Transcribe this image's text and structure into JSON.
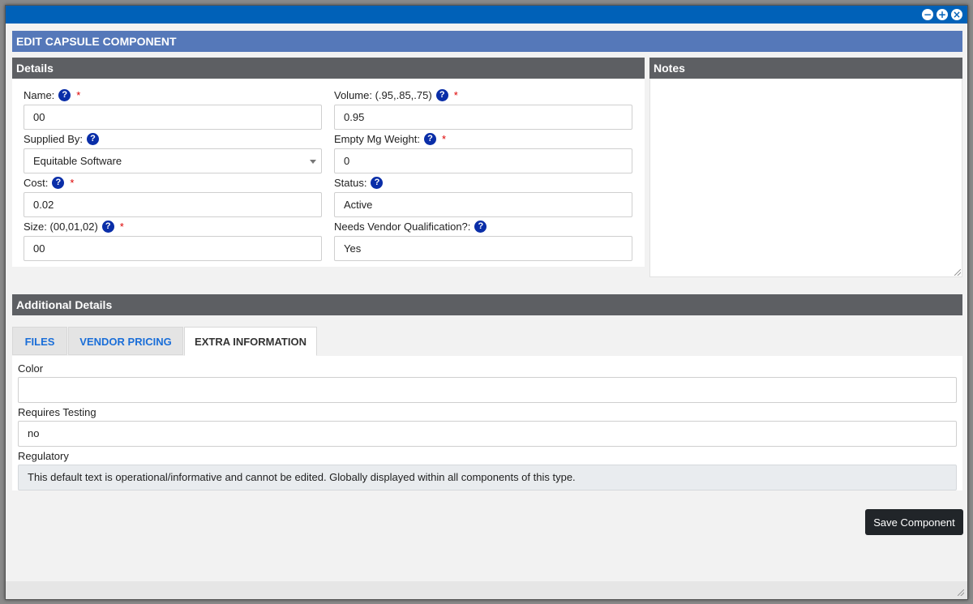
{
  "window": {
    "controls": [
      "−",
      "+",
      "×"
    ]
  },
  "dialog": {
    "title": "EDIT CAPSULE COMPONENT"
  },
  "details": {
    "title": "Details",
    "fields": [
      {
        "label": "Name:",
        "value": "00",
        "required": "*"
      },
      {
        "label": "Volume: (.95,.85,.75)",
        "value": "0.95",
        "required": "*"
      },
      {
        "label": "Supplied By:",
        "value": "Equitable Software"
      },
      {
        "label": "Empty Mg Weight:",
        "value": "0",
        "required": "*"
      },
      {
        "label": "Cost:",
        "value": "0.02",
        "required": "*"
      },
      {
        "label": "Status:",
        "value": "Active"
      },
      {
        "label": "Size: (00,01,02)",
        "value": "00",
        "required": "*"
      },
      {
        "label": "Needs Vendor Qualification?:",
        "value": "Yes"
      }
    ],
    "help_glyph": "?"
  },
  "notes": {
    "title": "Notes",
    "value": ""
  },
  "additional": {
    "title": "Additional Details",
    "tabs": [
      "FILES",
      "VENDOR PRICING",
      "EXTRA INFORMATION"
    ],
    "active_tab": "EXTRA INFORMATION",
    "extra_fields": [
      {
        "label": "Color",
        "value": ""
      },
      {
        "label": "Requires Testing",
        "value": "no"
      },
      {
        "label": "Regulatory",
        "value": "This default text is operational/informative and cannot be edited. Globally displayed within all components of this type."
      }
    ]
  },
  "actions": {
    "save_label": "Save Component"
  },
  "colors": {
    "titlebar": "#0061b8",
    "dialog_header": "#5578b9",
    "panel_header": "#5d5f63",
    "help_icon": "#0a2ea8",
    "required": "#dd0000",
    "tab_link": "#1a6ed8",
    "save_button": "#212529"
  }
}
